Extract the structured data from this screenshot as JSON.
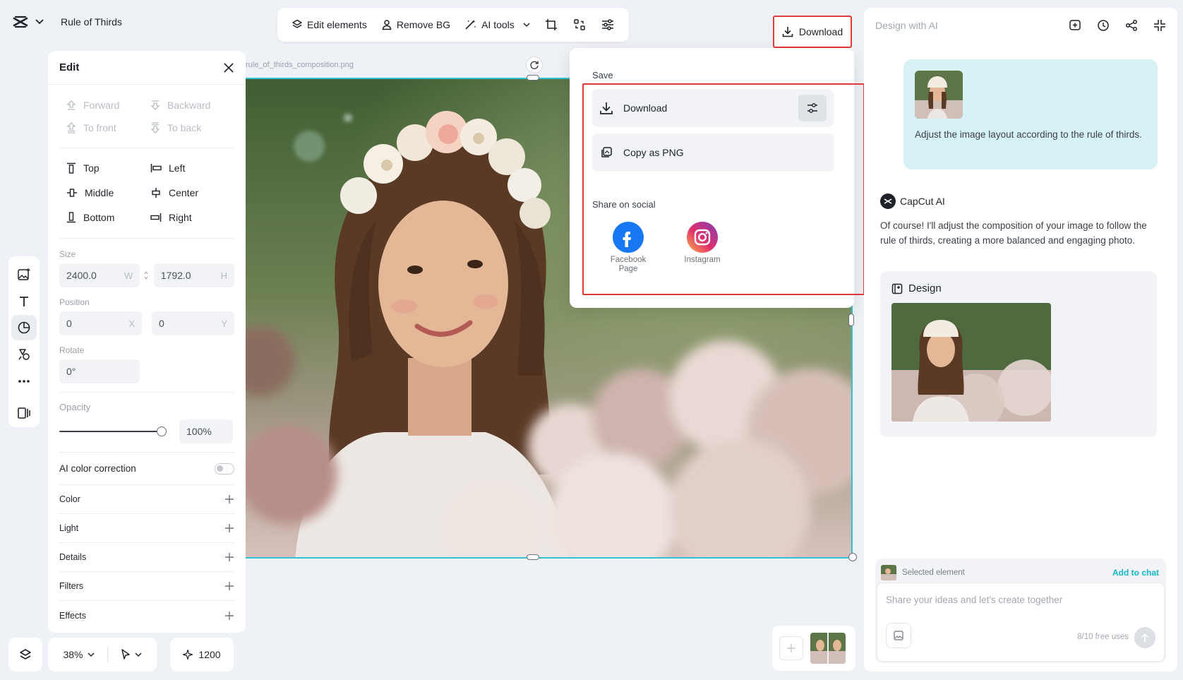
{
  "app": {
    "project_title": "Rule of Thirds"
  },
  "toolbar": {
    "edit_elements": "Edit elements",
    "remove_bg": "Remove BG",
    "ai_tools": "AI tools"
  },
  "download_button": {
    "label": "Download"
  },
  "chat": {
    "header_placeholder": "Design with AI",
    "user_message": "Adjust the image layout according to the rule of thirds.",
    "ai_name": "CapCut AI",
    "ai_message": "Of course! I'll adjust the composition of your image to follow the rule of thirds, creating a more balanced and engaging photo.",
    "design_title": "Design",
    "selected_element": "Selected element",
    "add_to_chat": "Add to chat",
    "input_placeholder": "Share your ideas and let's create together",
    "free_uses": "8/10 free uses"
  },
  "edit_panel": {
    "title": "Edit",
    "layer_actions": [
      "Forward",
      "Backward",
      "To front",
      "To back"
    ],
    "align": [
      "Top",
      "Left",
      "Middle",
      "Center",
      "Bottom",
      "Right"
    ],
    "size_label": "Size",
    "width": "2400.0",
    "width_suffix": "W",
    "height": "1792.0",
    "height_suffix": "H",
    "position_label": "Position",
    "pos_x": "0",
    "pos_x_suffix": "X",
    "pos_y": "0",
    "pos_y_suffix": "Y",
    "rotate_label": "Rotate",
    "rotate": "0°",
    "opacity_label": "Opacity",
    "opacity_value": "100%",
    "opacity_fraction": 1.0,
    "ai_color_correction": "AI color correction",
    "ai_color_correction_on": false,
    "adjust_rows": [
      "Color",
      "Light",
      "Details",
      "Filters",
      "Effects"
    ]
  },
  "canvas": {
    "filename": "rule_of_thirds_composition.png"
  },
  "popover": {
    "save_label": "Save",
    "download": "Download",
    "copy_png": "Copy as PNG",
    "share_label": "Share on social",
    "facebook": "Facebook Page",
    "instagram": "Instagram"
  },
  "bottom": {
    "zoom": "38%",
    "credits": "1200"
  },
  "colors": {
    "accent": "#15b6c7",
    "highlight": "#e03a3a",
    "selection": "#32c3d3"
  }
}
